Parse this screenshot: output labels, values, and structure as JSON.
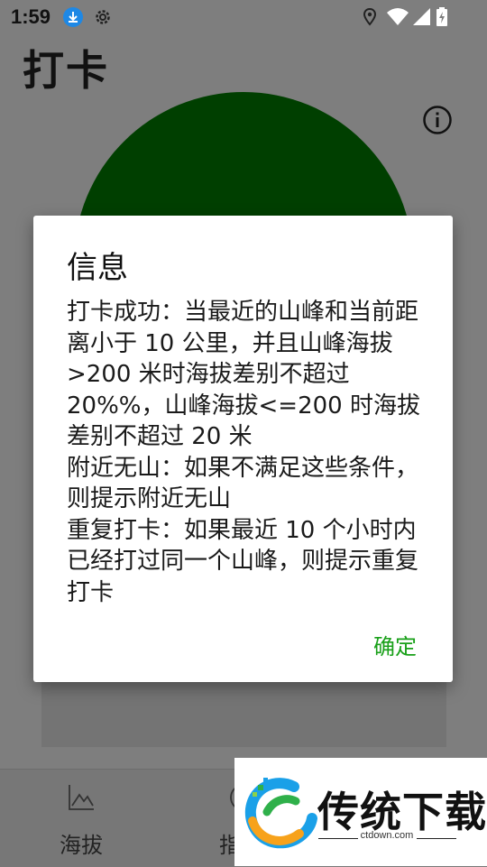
{
  "status_bar": {
    "time": "1:59",
    "icons": [
      "download-icon",
      "settings-gear-icon",
      "location-icon",
      "wifi-icon",
      "signal-icon",
      "battery-charging-icon"
    ]
  },
  "header": {
    "title": "打卡"
  },
  "dialog": {
    "title": "信息",
    "body": "打卡成功：当最近的山峰和当前距离小于 10 公里，并且山峰海拔>200 米时海拔差别不超过 20%%，山峰海拔<=200 时海拔差别不超过 20 米\n附近无山：如果不满足这些条件，则提示附近无山\n重复打卡：如果最近 10 个小时内已经打过同一个山峰，则提示重复打卡",
    "ok_label": "确定"
  },
  "bottom_nav": {
    "items": [
      {
        "label": "海拔",
        "icon": "mountain-chart-icon"
      },
      {
        "label": "指",
        "icon": "compass-icon"
      }
    ]
  },
  "watermark": {
    "name": "传统下载",
    "domain": "ctdown.com"
  },
  "colors": {
    "circle": "#003f00",
    "ok_button": "#19a019",
    "scrim": "#7e7e7e"
  }
}
